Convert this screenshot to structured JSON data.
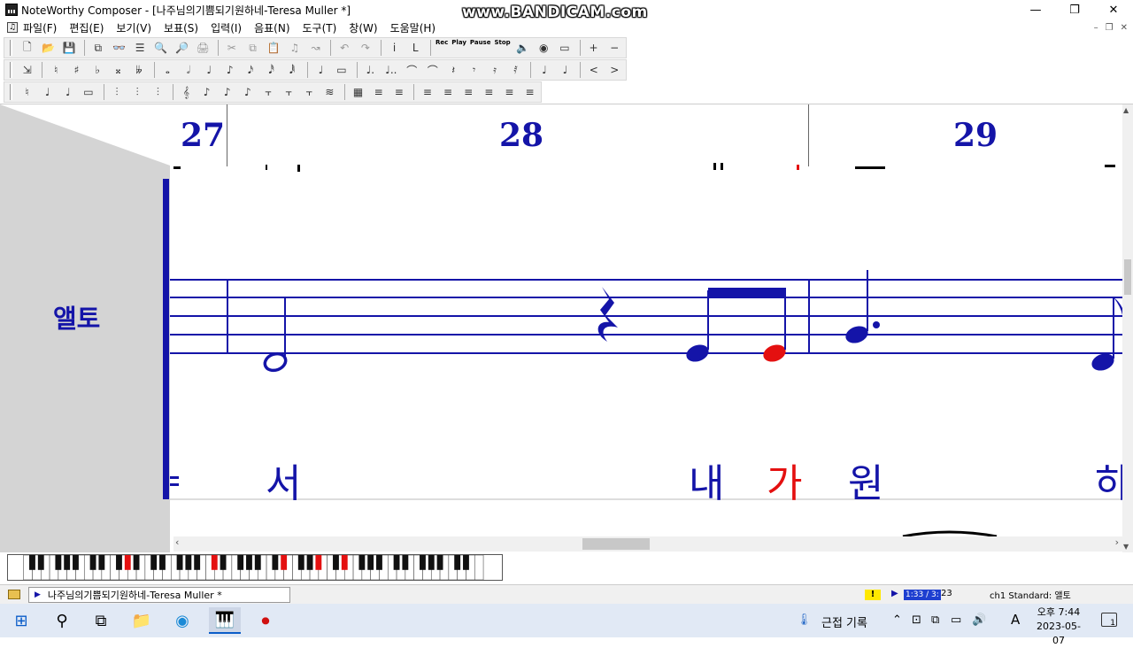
{
  "window": {
    "title": "NoteWorthy Composer - [나주님의기쁨되기원하네-Teresa Muller *]",
    "watermark": "www.BANDICAM.com",
    "controls": {
      "minimize": "—",
      "restore": "❐",
      "close": "✕"
    }
  },
  "menu": {
    "items": [
      "파일(F)",
      "편집(E)",
      "보기(V)",
      "보표(S)",
      "입력(I)",
      "음표(N)",
      "도구(T)",
      "창(W)",
      "도움말(H)"
    ],
    "mdi": {
      "minimize": "–",
      "restore": "❐",
      "close": "✕"
    }
  },
  "toolbar1": {
    "buttons": [
      "🗋",
      "📂",
      "💾",
      "⧉",
      "👓",
      "☰",
      "🔍",
      "🔎",
      "🖨",
      "✂",
      "⧉",
      "📋",
      "♫",
      "↝",
      "↶",
      "↷",
      "i",
      "L",
      "Rec",
      "Play",
      "Pause",
      "Stop",
      "🔈",
      "◉",
      "▭",
      "+",
      "−"
    ],
    "text": {
      "rec": "Rec",
      "play": "Play",
      "pause": "Pause",
      "stop": "Stop"
    }
  },
  "toolbar2": {
    "buttons": [
      "♮",
      "♯",
      "♭",
      "𝄪",
      "𝄫",
      "𝅝",
      "𝅗𝅥",
      "♩",
      "♪",
      "𝅘𝅥𝅯",
      "𝅘𝅥𝅰",
      "𝅘𝅥𝅱",
      "♩",
      "▭",
      "♩.",
      "♩..",
      "⌒",
      "⌒",
      "𝄽",
      "𝄾",
      "𝄿",
      "𝅀",
      "♩",
      "♩",
      "<",
      ">"
    ]
  },
  "toolbar3": {
    "buttons": [
      "♮",
      "♩",
      "♩",
      "▭",
      "⫶",
      "⫶",
      "⫶",
      "𝄞",
      "♪",
      "♪",
      "♪",
      "⫟",
      "⫟",
      "⫟",
      "≋",
      "▦",
      "≡",
      "≡",
      "≡",
      "≡",
      "≡",
      "≡",
      "≡",
      "≡",
      "≡"
    ]
  },
  "score": {
    "bar_numbers": [
      "27",
      "28",
      "29"
    ],
    "staff_name": "앨토",
    "lyrics": [
      {
        "text": "서",
        "color": "blue"
      },
      {
        "text": "내",
        "color": "blue"
      },
      {
        "text": "가",
        "color": "red"
      },
      {
        "text": "원",
        "color": "blue"
      },
      {
        "text": "하",
        "color": "blue"
      }
    ],
    "top_lyric_fragment": "ㄴ",
    "colors": {
      "staff": "#1414a8",
      "highlight": "#e41010"
    }
  },
  "scrollbars": {
    "left": "‹",
    "right": "›",
    "up": "▲",
    "down": "▼"
  },
  "status": {
    "doc_tab": "나주님의기쁨되기원하네-Teresa Muller *",
    "warning": "!",
    "play_arrow": "▶",
    "time_current": "1:33 / 3:",
    "time_tail": "23",
    "channel": "ch1 Standard: 앨토"
  },
  "taskbar": {
    "start": "⊞",
    "search": "⚲",
    "taskview": "⧉",
    "explorer": "📁",
    "edge": "◉",
    "nwc": "🎹",
    "rec": "⏺",
    "weather": "🌡",
    "weather_text": "근접 기록",
    "tray_icons": [
      "⌃",
      "⊡",
      "⧉",
      "▭",
      "🔊",
      "A"
    ],
    "time": "오후 7:44",
    "date": "2023-05-07",
    "notification": "1"
  }
}
